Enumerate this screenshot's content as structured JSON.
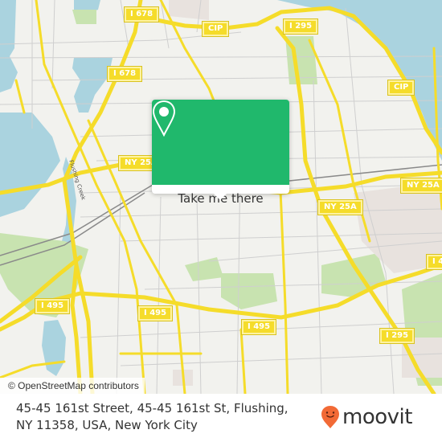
{
  "map": {
    "colors": {
      "land": "#f2f2ee",
      "water": "#aad3df",
      "park": "#c8e3b0",
      "urban": "#e8e2de",
      "highway": "#f5dc2a",
      "road": "#c8c8c8",
      "rail": "#888888"
    },
    "shields": [
      {
        "label": "I 678",
        "id": "i678-north"
      },
      {
        "label": "CIP",
        "id": "cip-north"
      },
      {
        "label": "I 295",
        "id": "i295-north"
      },
      {
        "label": "I 678",
        "id": "i678-mid"
      },
      {
        "label": "CIP",
        "id": "cip-east"
      },
      {
        "label": "NY 25A",
        "id": "ny25a-west"
      },
      {
        "label": "NY 25A",
        "id": "ny25a-east"
      },
      {
        "label": "NY 25A",
        "id": "ny25a-center"
      },
      {
        "label": "I 495",
        "id": "i495-west"
      },
      {
        "label": "I 495",
        "id": "i495-mid"
      },
      {
        "label": "I 495",
        "id": "i495-east"
      },
      {
        "label": "I 295",
        "id": "i295-south"
      },
      {
        "label": "I 4",
        "id": "i495-edge"
      }
    ],
    "street_label": "Flushing Creek",
    "attribution": "© OpenStreetMap contributors"
  },
  "popup": {
    "icon": "map-pin-icon",
    "button_label": "Take me there",
    "accent": "#20b86c"
  },
  "footer": {
    "address": "45-45 161st Street, 45-45 161st St, Flushing, NY 11358, USA, New York City",
    "brand": {
      "name": "moovit",
      "icon": "moovit-pin-icon",
      "accent": "#f26a36"
    }
  }
}
